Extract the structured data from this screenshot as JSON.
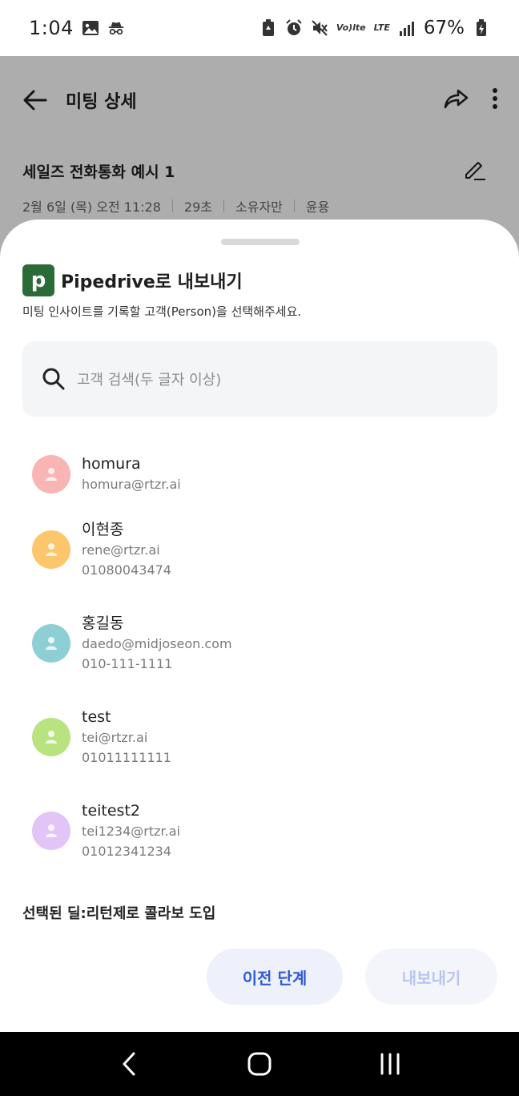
{
  "status_bar": {
    "time": "1:04",
    "battery": "67%",
    "network_label": "LTE",
    "volte_label": "Vo)lte"
  },
  "app_bar": {
    "title": "미팅 상세"
  },
  "meeting": {
    "title": "세일즈 전화통화 예시 1",
    "date": "2월 6일 (목) 오전 11:28",
    "duration": "29초",
    "owner": "소유자만",
    "speaker": "윤용"
  },
  "sheet": {
    "logo_letter": "p",
    "title": "Pipedrive로 내보내기",
    "description": "미팅 인사이트를 기록할 고객(Person)을 선택해주세요.",
    "search_placeholder": "고객 검색(두 글자 이상)",
    "contacts": [
      {
        "name": "homura",
        "email": "homura@rtzr.ai",
        "phone": "",
        "color": "#f9b4b4"
      },
      {
        "name": "이현종",
        "email": "rene@rtzr.ai",
        "phone": "01080043474",
        "color": "#fcc76c"
      },
      {
        "name": "홍길동",
        "email": "daedo@midjoseon.com",
        "phone": "010-111-1111",
        "color": "#8ecfd6"
      },
      {
        "name": "test",
        "email": "tei@rtzr.ai",
        "phone": "01011111111",
        "color": "#b9e37f"
      },
      {
        "name": "teitest2",
        "email": "tei1234@rtzr.ai",
        "phone": "01012341234",
        "color": "#e2c4f7"
      }
    ],
    "selected_deal": "선택된 딜:리턴제로 콜라보 도입",
    "prev_button": "이전 단계",
    "export_button": "내보내기"
  },
  "colors": {
    "accent": "#2f5bd3",
    "pipedrive_green": "#2b6b37"
  }
}
